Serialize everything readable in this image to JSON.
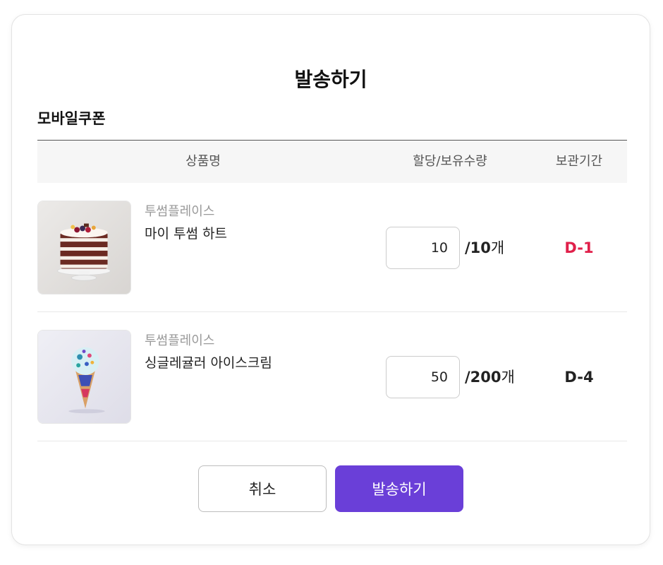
{
  "dialog": {
    "title": "발송하기",
    "section_title": "모바일쿠폰"
  },
  "table": {
    "headers": {
      "product": "상품명",
      "quantity": "할당/보유수량",
      "period": "보관기간"
    },
    "rows": [
      {
        "brand": "투썸플레이스",
        "name": "마이 투썸 하트",
        "quantity_value": "10",
        "total": "/10",
        "unit": "개",
        "period": "D-1",
        "period_color": "#e0204a",
        "thumbnail": "cake-image"
      },
      {
        "brand": "투썸플레이스",
        "name": "싱글레귤러 아이스크림",
        "quantity_value": "50",
        "total": "/200",
        "unit": "개",
        "period": "D-4",
        "period_color": "#222222",
        "thumbnail": "ice-cream-cone-image"
      }
    ]
  },
  "actions": {
    "cancel_label": "취소",
    "send_label": "발송하기"
  },
  "colors": {
    "accent": "#6a3fd8",
    "urgent": "#e0204a"
  }
}
